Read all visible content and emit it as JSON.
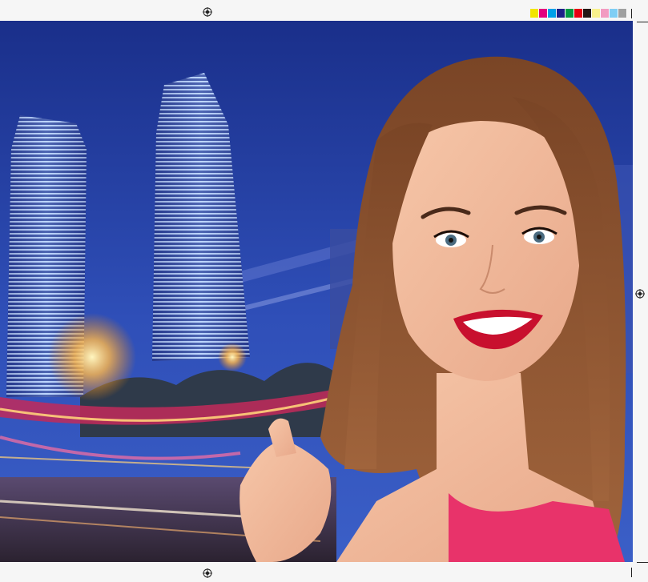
{
  "sheet": {
    "background": "#f6f6f6",
    "color_bar": [
      "#f2e500",
      "#e4007f",
      "#00a0e9",
      "#1d2088",
      "#009944",
      "#e60012",
      "#231815",
      "#f8f08c",
      "#f29bc1",
      "#7fcef4",
      "#9fa0a0"
    ]
  },
  "photo": {
    "subject": "woman-smiling-portrait",
    "background_scene": "night-city-skyscrapers",
    "colors": {
      "sky_top": "#1a2f8a",
      "sky_bottom": "#3b5fc7",
      "hair": "#8a5230",
      "skin": "#f0b497",
      "lips": "#c8102e",
      "top": "#e8336a"
    }
  }
}
